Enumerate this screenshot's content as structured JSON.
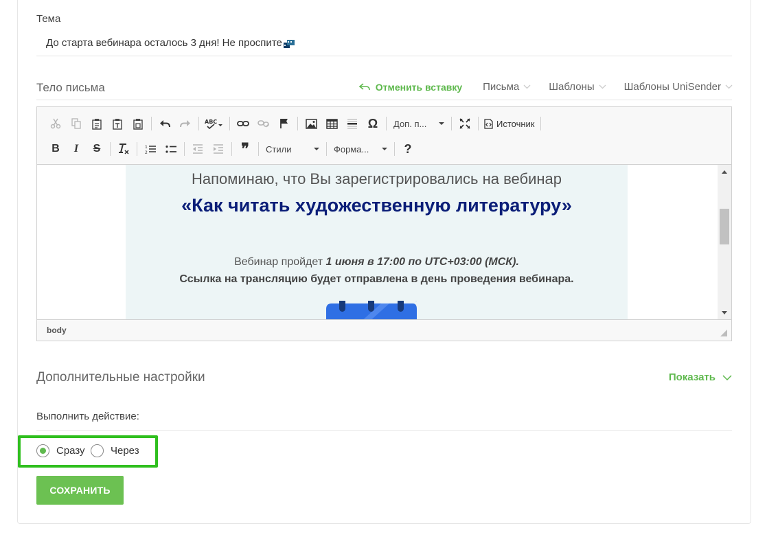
{
  "topic": {
    "label": "Тема",
    "value": "До старта вебинара осталось 3 дня! Не проспите"
  },
  "body": {
    "label": "Тело письма",
    "cancel_insert": "Отменить вставку",
    "letters_dd": "Письма",
    "templates_dd": "Шаблоны",
    "unisender_dd": "Шаблоны UniSender"
  },
  "toolbar": {
    "extra_combo": "Доп. п...",
    "source_label": "Источник",
    "bold": "B",
    "italic": "I",
    "strike": "S",
    "quote": "❞",
    "styles_combo": "Стили",
    "format_combo": "Форма...",
    "help": "?"
  },
  "email_content": {
    "reminder": "Напоминаю, что Вы зарегистрировались на вебинар",
    "webinar_title": "«Как читать художественную литературу»",
    "date_prefix": "Вебинар пройдет ",
    "date_value": "1 июня в 17:00 по UTC+03:00 (МСК).",
    "link_note": "Ссылка на трансляцию будет отправлена в день проведения вебинара."
  },
  "statusbar": {
    "path": "body"
  },
  "advanced": {
    "label": "Дополнительные настройки",
    "show": "Показать"
  },
  "action": {
    "label": "Выполнить действие:",
    "options": [
      {
        "label": "Сразу",
        "selected": true
      },
      {
        "label": "Через",
        "selected": false
      }
    ]
  },
  "save_button": "СОХРАНИТЬ",
  "colors": {
    "accent_green": "#5fb94e",
    "highlight_green": "#2fbf1e",
    "title_navy": "#0b1e78",
    "mail_bg": "#edf5f6"
  }
}
